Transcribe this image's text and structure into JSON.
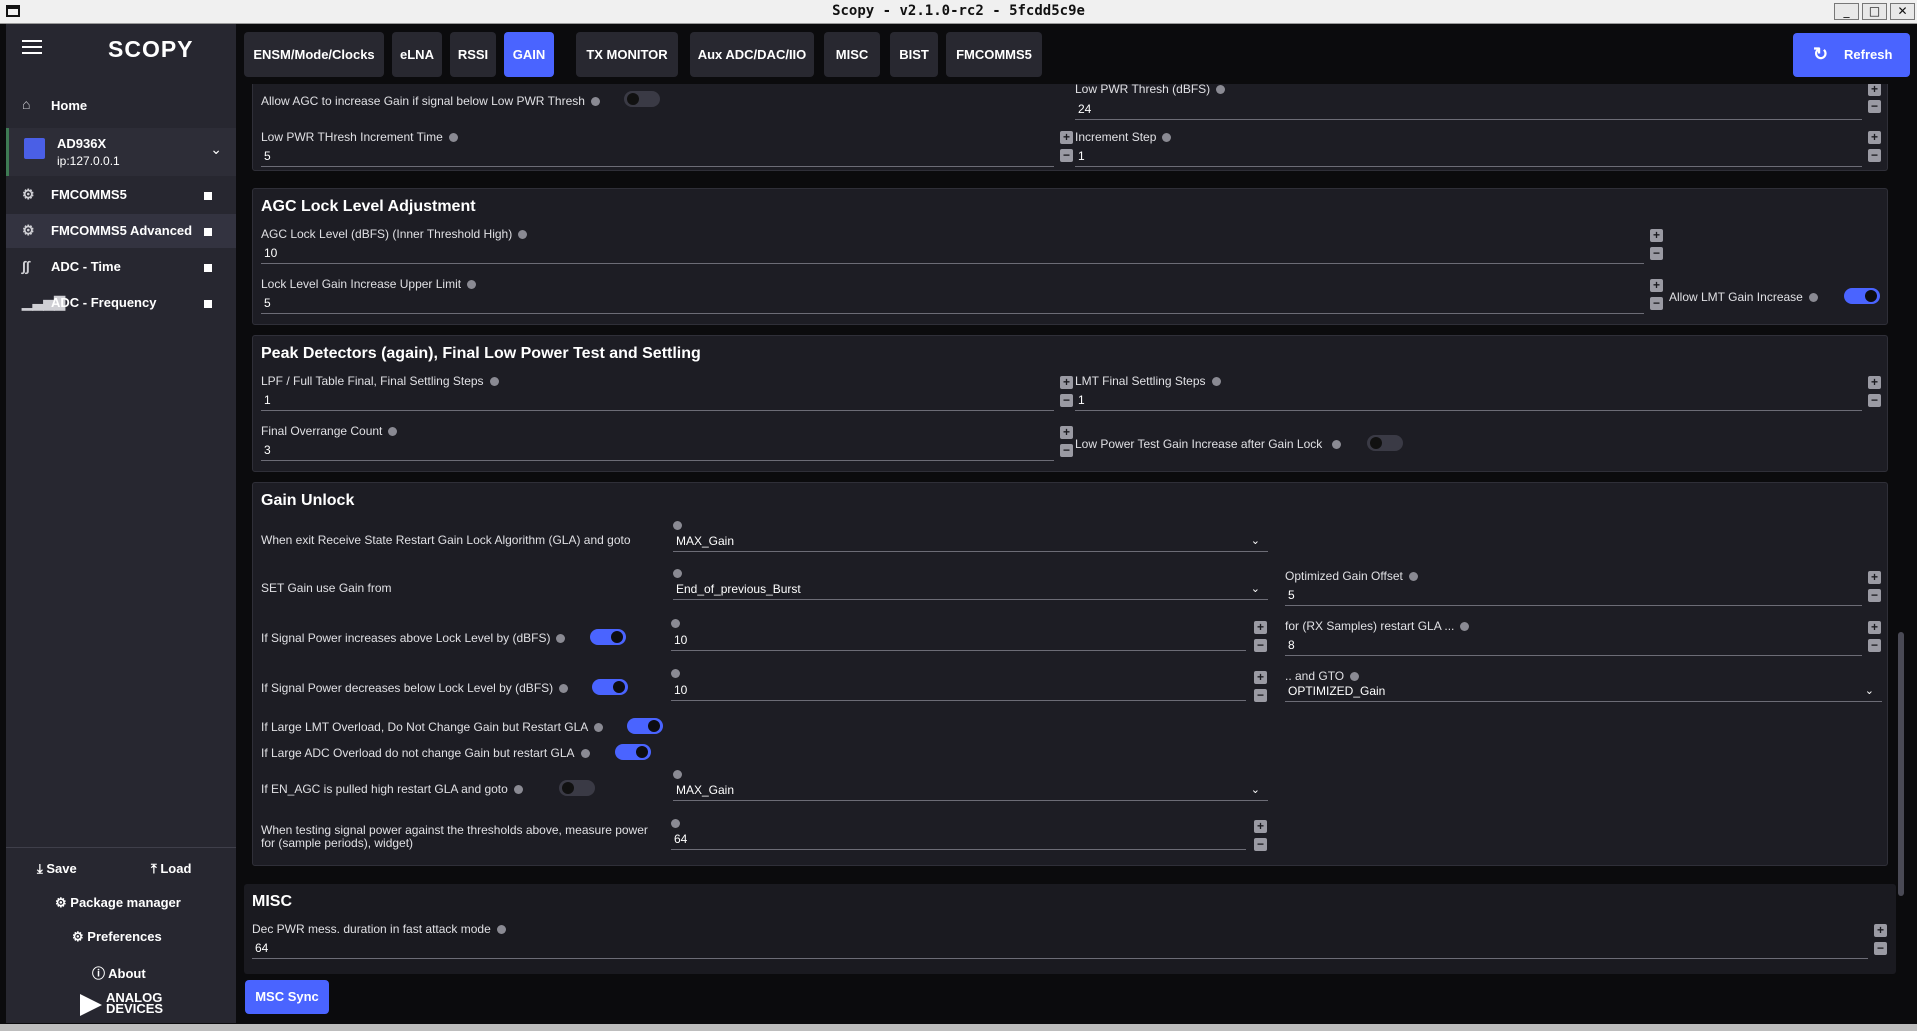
{
  "window": {
    "title": "Scopy - v2.1.0-rc2 - 5fcdd5c9e"
  },
  "sidebar": {
    "logo": "SCOPY",
    "home": "Home",
    "device": {
      "name": "AD936X",
      "ip": "ip:127.0.0.1"
    },
    "items": [
      {
        "label": "FMCOMMS5",
        "icon": "gear-icon"
      },
      {
        "label": "FMCOMMS5 Advanced",
        "icon": "gear-icon"
      },
      {
        "label": "ADC - Time",
        "icon": "wave-icon"
      },
      {
        "label": "ADC - Frequency",
        "icon": "bars-icon"
      }
    ],
    "save": "Save",
    "load": "Load",
    "package_manager": "Package manager",
    "preferences": "Preferences",
    "about": "About",
    "brand_line1": "ANALOG",
    "brand_line2": "DEVICES"
  },
  "tabs": [
    "ENSM/Mode/Clocks",
    "eLNA",
    "RSSI",
    "GAIN",
    "TX MONITOR",
    "Aux ADC/DAC/IIO",
    "MISC",
    "BIST",
    "FMCOMMS5"
  ],
  "active_tab": "GAIN",
  "refresh": "Refresh",
  "top": {
    "allow_agc_label": "Allow AGC to increase Gain if signal below Low PWR Thresh",
    "allow_agc_on": false,
    "low_pwr_thresh_label": "Low PWR Thresh (dBFS)",
    "low_pwr_thresh_value": "24",
    "low_pwr_inc_time_label": "Low PWR THresh Increment Time",
    "low_pwr_inc_time_value": "5",
    "increment_step_label": "Increment Step",
    "increment_step_value": "1"
  },
  "agc_lock": {
    "title": "AGC Lock Level Adjustment",
    "lock_level_label": "AGC Lock Level (dBFS) (Inner Threshold High)",
    "lock_level_value": "10",
    "upper_limit_label": "Lock Level Gain Increase Upper Limit",
    "upper_limit_value": "5",
    "allow_lmt_label": "Allow LMT Gain Increase",
    "allow_lmt_on": true
  },
  "peak": {
    "title": "Peak Detectors (again), Final Low Power Test and Settling",
    "lpf_label": "LPF / Full Table Final, Final Settling Steps",
    "lpf_value": "1",
    "lmt_label": "LMT Final Settling Steps",
    "lmt_value": "1",
    "overrange_label": "Final Overrange Count",
    "overrange_value": "3",
    "low_power_test_label": "Low Power Test Gain Increase after Gain Lock",
    "low_power_test_on": false
  },
  "gain_unlock": {
    "title": "Gain Unlock",
    "exit_rx_label": "When exit Receive State Restart Gain Lock Algorithm (GLA) and goto",
    "exit_rx_value": "MAX_Gain",
    "set_gain_label": "SET Gain use Gain from",
    "set_gain_value": "End_of_previous_Burst",
    "opt_offset_label": "Optimized Gain Offset",
    "opt_offset_value": "5",
    "sig_inc_label": "If Signal Power increases above Lock Level by (dBFS)",
    "sig_inc_value": "10",
    "rx_samples_label": "for (RX Samples) restart GLA ...",
    "rx_samples_value": "8",
    "sig_dec_label": "If Signal Power decreases below Lock Level by (dBFS)",
    "sig_dec_value": "10",
    "gto_label": ".. and GTO",
    "gto_value": "OPTIMIZED_Gain",
    "lmt_overload_label": "If Large LMT Overload, Do Not Change Gain but Restart GLA",
    "adc_overload_label": "If Large ADC Overload do not change Gain but restart GLA",
    "en_agc_label": "If EN_AGC is pulled high restart GLA and goto",
    "en_agc_value": "MAX_Gain",
    "measure_label_1": "When testing signal power against the thresholds above, measure power",
    "measure_label_2": "for (sample periods), widget)",
    "measure_value": "64"
  },
  "misc": {
    "title": "MISC",
    "dec_pwr_label": "Dec PWR mess. duration in fast attack mode",
    "dec_pwr_value": "64"
  },
  "msc_sync": "MSC Sync",
  "colors": {
    "accent": "#4a64ff",
    "sidebar": "#272730",
    "panel": "#1d1d24",
    "background": "#0b0b0d"
  }
}
